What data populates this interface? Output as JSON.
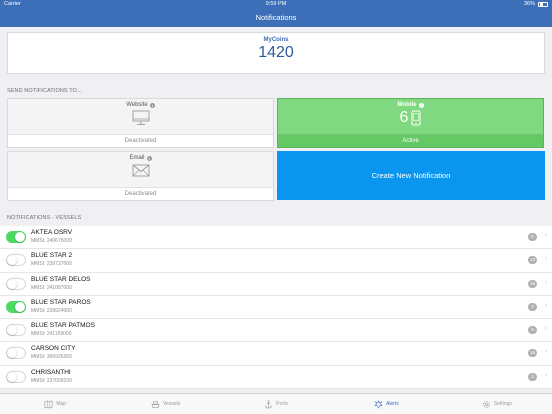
{
  "status_bar": {
    "carrier": "Carrier",
    "time": "9:59 PM",
    "battery": "36%"
  },
  "nav": {
    "title": "Notifications"
  },
  "coins": {
    "label": "MyCoins",
    "value": "1420"
  },
  "send_section": {
    "title": "SEND NOTIFICATIONS TO..."
  },
  "channels": {
    "website": {
      "title": "Website",
      "status": "Deactivated"
    },
    "mobile": {
      "title": "Mobile",
      "count": "6",
      "status": "Active"
    },
    "email": {
      "title": "Email",
      "status": "Deactivated"
    }
  },
  "create_button": {
    "label": "Create New Notification"
  },
  "vessels_section": {
    "title": "NOTIFICATIONS - VESSELS"
  },
  "vessels": [
    {
      "name": "AKTEA OSRV",
      "mmsi": "MMSI: 240675000",
      "count": "6",
      "enabled": true
    },
    {
      "name": "BLUE STAR 2",
      "mmsi": "MMSI: 239737000",
      "count": "13",
      "enabled": false
    },
    {
      "name": "BLUE STAR DELOS",
      "mmsi": "MMSI: 241087000",
      "count": "16",
      "enabled": false
    },
    {
      "name": "BLUE STAR PAROS",
      "mmsi": "MMSI: 239924000",
      "count": "2",
      "enabled": true
    },
    {
      "name": "BLUE STAR PATMOS",
      "mmsi": "MMSI: 241159000",
      "count": "5",
      "enabled": false
    },
    {
      "name": "CARSON CITY",
      "mmsi": "MMSI: 366926260",
      "count": "16",
      "enabled": false
    },
    {
      "name": "CHRISANTHI",
      "mmsi": "MMSI: 237009100",
      "count": "3",
      "enabled": false
    }
  ],
  "tabs": [
    {
      "label": "Map",
      "icon": "map-icon"
    },
    {
      "label": "Vessels",
      "icon": "vessel-icon"
    },
    {
      "label": "Ports",
      "icon": "anchor-icon"
    },
    {
      "label": "Alerts",
      "icon": "alerts-icon",
      "active": true
    },
    {
      "label": "Settings",
      "icon": "gear-icon"
    }
  ],
  "colors": {
    "primary": "#3d6fb8",
    "active_green": "#64c864",
    "create_blue": "#0a95ee",
    "toggle_on": "#4cd964"
  }
}
